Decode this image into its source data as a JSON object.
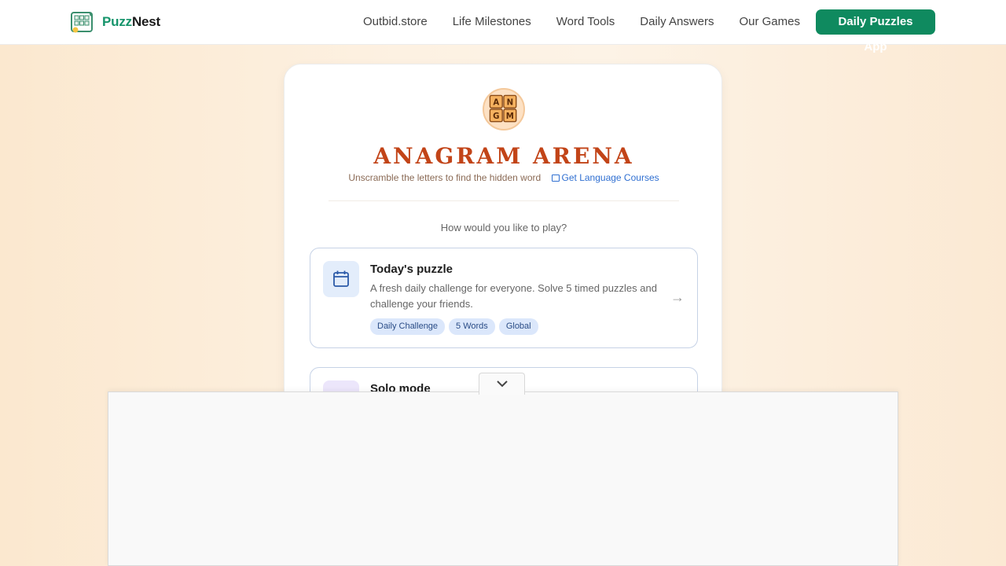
{
  "header": {
    "brand_part1": "Puzz",
    "brand_part2": "Nest",
    "nav": [
      "Outbid.store",
      "Life Milestones",
      "Word Tools",
      "Daily Answers",
      "Our Games"
    ],
    "cta": "Daily Puzzles App"
  },
  "game": {
    "logo_letters": [
      "A",
      "N",
      "G",
      "M"
    ],
    "title": "ANAGRAM ARENA",
    "subtitle": "Unscramble the letters to find the hidden word",
    "language_link": "Get Language Courses",
    "prompt": "How would you like to play?"
  },
  "options": [
    {
      "title": "Today's puzzle",
      "description": "A fresh daily challenge for everyone. Solve 5 timed puzzles and challenge your friends.",
      "tags": [
        "Daily Challenge",
        "5 Words",
        "Global"
      ],
      "arrow": "→"
    },
    {
      "title": "Solo mode"
    }
  ],
  "colors": {
    "brand_green": "#0f8a5f",
    "title_orange": "#c24418",
    "link_blue": "#2f6fd1"
  }
}
